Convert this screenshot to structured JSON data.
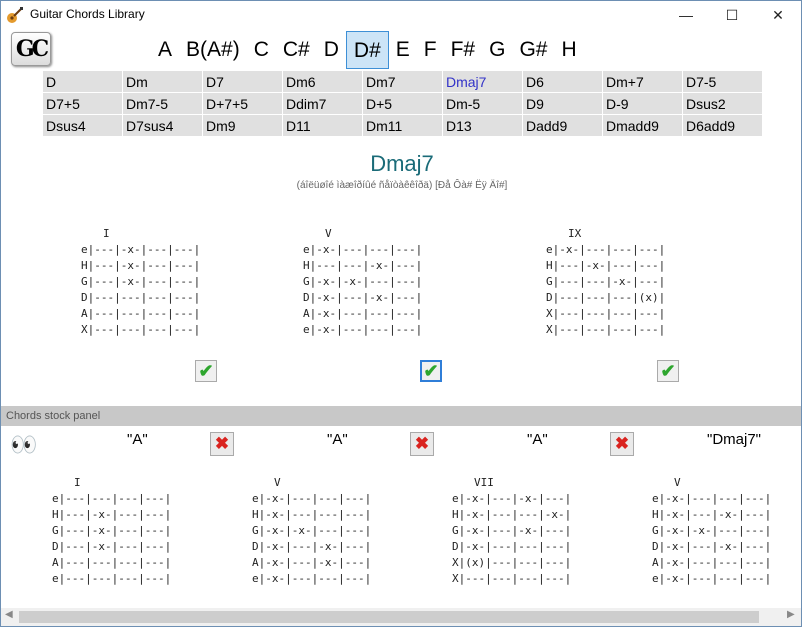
{
  "window": {
    "title": "Guitar Chords Library",
    "minimize": "—",
    "maximize": "☐",
    "close": "✕"
  },
  "logo": "GC",
  "keys": [
    "A",
    "B(A#)",
    "C",
    "C#",
    "D",
    "D#",
    "E",
    "F",
    "F#",
    "G",
    "G#",
    "H"
  ],
  "selected_key": "D#",
  "chords": [
    "D",
    "Dm",
    "D7",
    "Dm6",
    "Dm7",
    "Dmaj7",
    "D6",
    "Dm+7",
    "D7-5",
    "D7+5",
    "Dm7-5",
    "D+7+5",
    "Ddim7",
    "D+5",
    "Dm-5",
    "D9",
    "D-9",
    "Dsus2",
    "Dsus4",
    "D7sus4",
    "Dm9",
    "D11",
    "Dm11",
    "D13",
    "Dadd9",
    "Dmadd9",
    "D6add9"
  ],
  "selected_chord": "Dmaj7",
  "chord_title": "Dmaj7",
  "chord_subtitle": "(áîëüøîé ìàæîðíûé ñåïòàêêîðä) [Ðå Ôà# Ëÿ Äî#]",
  "fingerings": [
    {
      "position": "I",
      "lines": [
        "e|---|-x-|---|---|",
        "H|---|-x-|---|---|",
        "G|---|-x-|---|---|",
        "D|---|---|---|---|",
        "A|---|---|---|---|",
        "X|---|---|---|---|"
      ]
    },
    {
      "position": "V",
      "lines": [
        "e|-x-|---|---|---|",
        "H|---|---|-x-|---|",
        "G|-x-|-x-|---|---|",
        "D|-x-|---|-x-|---|",
        "A|-x-|---|---|---|",
        "e|-x-|---|---|---|"
      ]
    },
    {
      "position": "IX",
      "lines": [
        "e|-x-|---|---|---|",
        "H|---|-x-|---|---|",
        "G|---|---|-x-|---|",
        "D|---|---|---|(x)|",
        "X|---|---|---|---|",
        "X|---|---|---|---|"
      ]
    }
  ],
  "panel_title": "Chords stock panel",
  "stock_names": [
    "\"A\"",
    "\"A\"",
    "\"A\"",
    "\"Dmaj7\""
  ],
  "stock_fingerings": [
    {
      "position": "I",
      "lines": [
        "e|---|---|---|---|",
        "H|---|-x-|---|---|",
        "G|---|-x-|---|---|",
        "D|---|-x-|---|---|",
        "A|---|---|---|---|",
        "e|---|---|---|---|"
      ]
    },
    {
      "position": "V",
      "lines": [
        "e|-x-|---|---|---|",
        "H|-x-|---|---|---|",
        "G|-x-|-x-|---|---|",
        "D|-x-|---|-x-|---|",
        "A|-x-|---|-x-|---|",
        "e|-x-|---|---|---|"
      ]
    },
    {
      "position": "VII",
      "lines": [
        "e|-x-|---|-x-|---|",
        "H|-x-|---|---|-x-|",
        "G|-x-|---|-x-|---|",
        "D|-x-|---|---|---|",
        "X|(x)|---|---|---|",
        "X|---|---|---|---|"
      ]
    },
    {
      "position": "V",
      "lines": [
        "e|-x-|---|---|---|",
        "H|-x-|---|-x-|---|",
        "G|-x-|-x-|---|---|",
        "D|-x-|---|-x-|---|",
        "A|-x-|---|---|---|",
        "e|-x-|---|---|---|"
      ]
    }
  ],
  "icons": {
    "check": "checkmark-icon",
    "delete": "red-x-icon",
    "eyes": "eyes-icon",
    "app": "guitar-icon"
  },
  "colors": {
    "accent": "#3d8fd6",
    "chord_title": "#1a6b78",
    "selected_chord": "#3232c8",
    "check": "#2ea62e",
    "delete": "#d9231f"
  }
}
